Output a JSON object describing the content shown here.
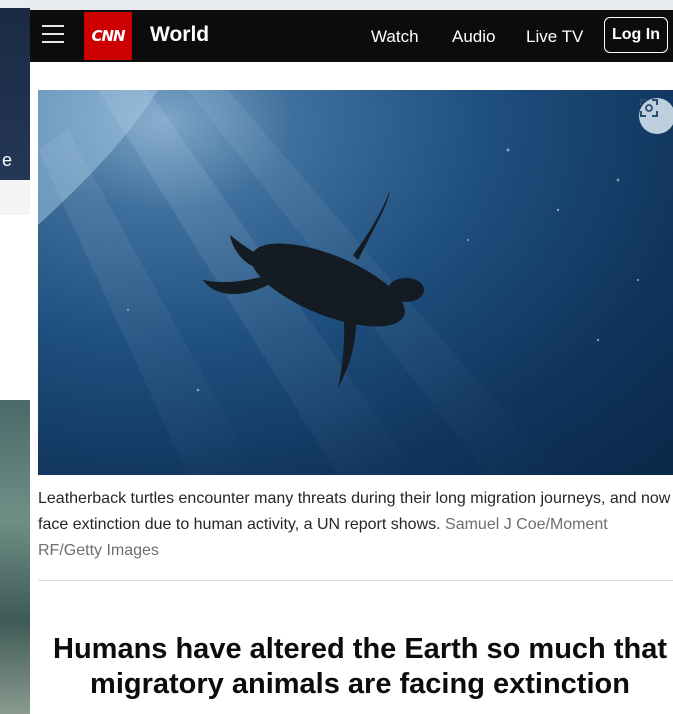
{
  "background_window": {
    "fragment_text": "e"
  },
  "header": {
    "menu_icon": "hamburger-icon",
    "logo_text": "CNN",
    "logo_color": "#cc0000",
    "section": "World",
    "nav_links": [
      "Watch",
      "Audio",
      "Live TV"
    ],
    "login_label": "Log In"
  },
  "hero": {
    "expand_icon": "expand-icon",
    "caption": "Leatherback turtles encounter many threats during their long migration journeys, and now face extinction due to human activity, a UN report shows.",
    "credit": "Samuel J Coe/Moment RF/Getty Images"
  },
  "article": {
    "headline_line1": "Humans have altered the Earth so much that",
    "headline_line2": "migratory animals are facing extinction"
  }
}
